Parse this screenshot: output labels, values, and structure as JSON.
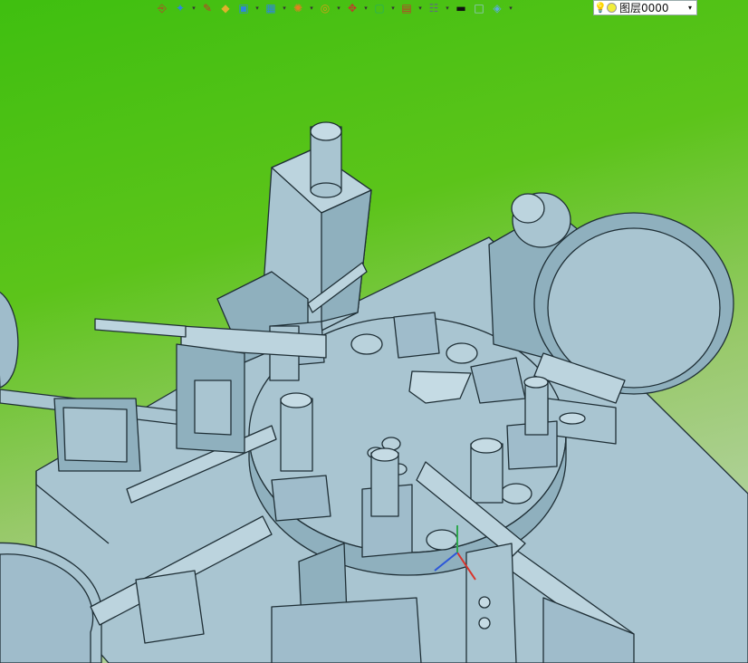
{
  "window": {
    "title": ""
  },
  "toolbar": {
    "buttons": [
      {
        "name": "import-icon",
        "glyph": "⎆",
        "color": "#c0392b",
        "dropdown": false
      },
      {
        "name": "lightbulb-icon",
        "glyph": "✦",
        "color": "#2e86de",
        "dropdown": true
      },
      {
        "name": "pencil-icon",
        "glyph": "✎",
        "color": "#c0392b",
        "dropdown": false
      },
      {
        "name": "solid-box-icon",
        "glyph": "◆",
        "color": "#e1b12c",
        "dropdown": false
      },
      {
        "name": "cube-icon",
        "glyph": "▣",
        "color": "#2e86de",
        "dropdown": true
      },
      {
        "name": "view-cube-icon",
        "glyph": "▦",
        "color": "#2e86de",
        "dropdown": true
      },
      {
        "name": "render-mode-icon",
        "glyph": "✺",
        "color": "#e67e22",
        "dropdown": true
      },
      {
        "name": "zoom-icon",
        "glyph": "◎",
        "color": "#d4a017",
        "dropdown": true
      },
      {
        "name": "pan-axes-icon",
        "glyph": "✥",
        "color": "#c0392b",
        "dropdown": true
      },
      {
        "name": "fit-view-icon",
        "glyph": "▢",
        "color": "#27ae60",
        "dropdown": true
      },
      {
        "name": "section-view-icon",
        "glyph": "▤",
        "color": "#c0392b",
        "dropdown": true
      },
      {
        "name": "display-settings-icon",
        "glyph": "☷",
        "color": "#5d6d7e",
        "dropdown": true
      },
      {
        "name": "line-color-icon",
        "glyph": "▬",
        "color": "#111111",
        "dropdown": false
      },
      {
        "name": "fill-color-icon",
        "glyph": "□",
        "color": "#9bc7e0",
        "dropdown": false
      },
      {
        "name": "plane-icon",
        "glyph": "◈",
        "color": "#5dade2",
        "dropdown": true
      }
    ]
  },
  "layer": {
    "label": "图层0000",
    "bulb": "💡",
    "caret": "▾",
    "dot_color": "#f1ee3a"
  },
  "colors": {
    "model_face": "#a9c5d1",
    "model_dark": "#84a6b5",
    "model_edge": "#1f2f36",
    "bg_top": "#3fbf10",
    "bg_bottom": "#c6d9c6"
  }
}
